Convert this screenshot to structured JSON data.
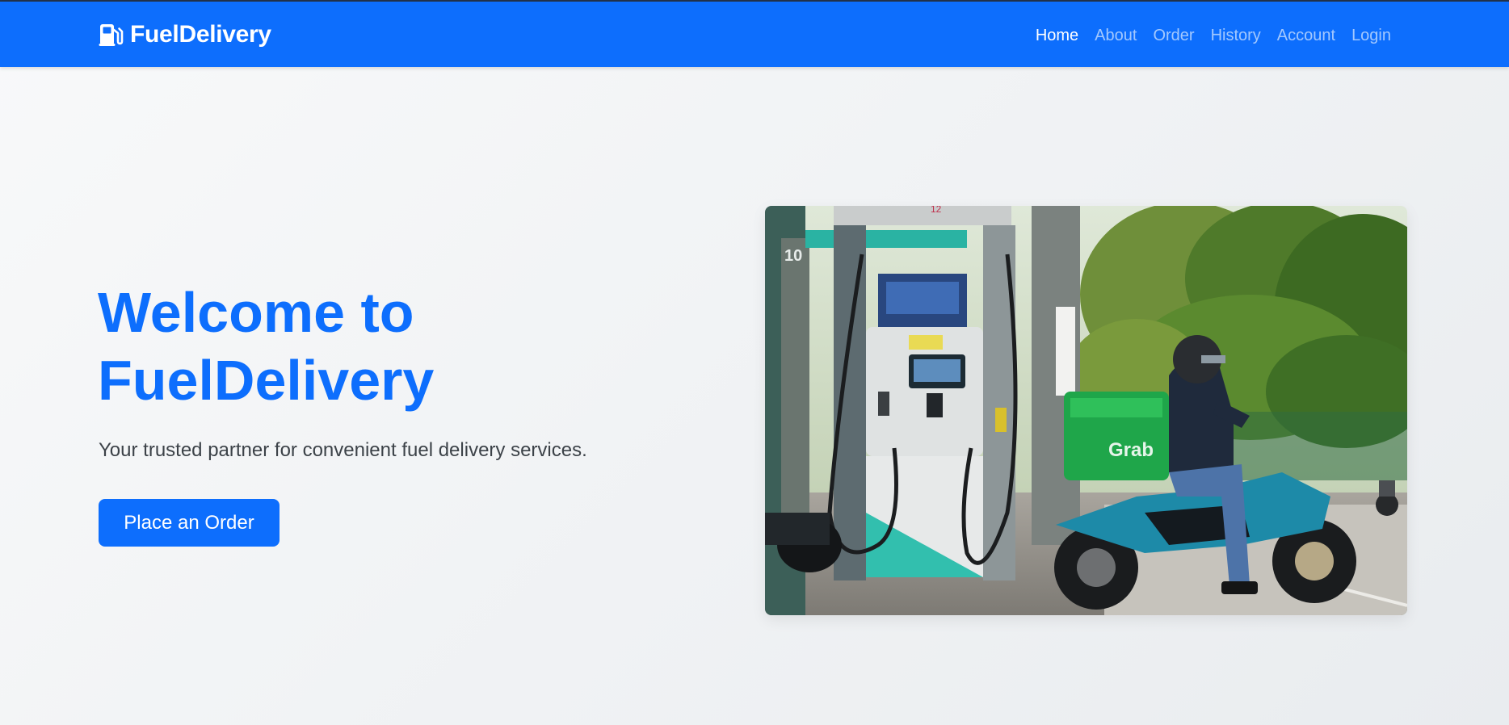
{
  "brand": {
    "name": "FuelDelivery",
    "icon": "gas-pump-icon"
  },
  "nav": [
    {
      "label": "Home",
      "active": true
    },
    {
      "label": "About",
      "active": false
    },
    {
      "label": "Order",
      "active": false
    },
    {
      "label": "History",
      "active": false
    },
    {
      "label": "Account",
      "active": false
    },
    {
      "label": "Login",
      "active": false
    }
  ],
  "hero": {
    "title_line1": "Welcome to",
    "title_line2": "FuelDelivery",
    "subtitle": "Your trusted partner for convenient fuel delivery services.",
    "cta_label": "Place an Order"
  },
  "image": {
    "description_alt": "Delivery rider on a motorcycle at a fuel pump",
    "pump_number": "12",
    "bay_number": "10",
    "box_brand": "Grab"
  },
  "colors": {
    "primary": "#0d6efd",
    "background": "#f8f9fa",
    "text_muted": "#3c4248"
  }
}
